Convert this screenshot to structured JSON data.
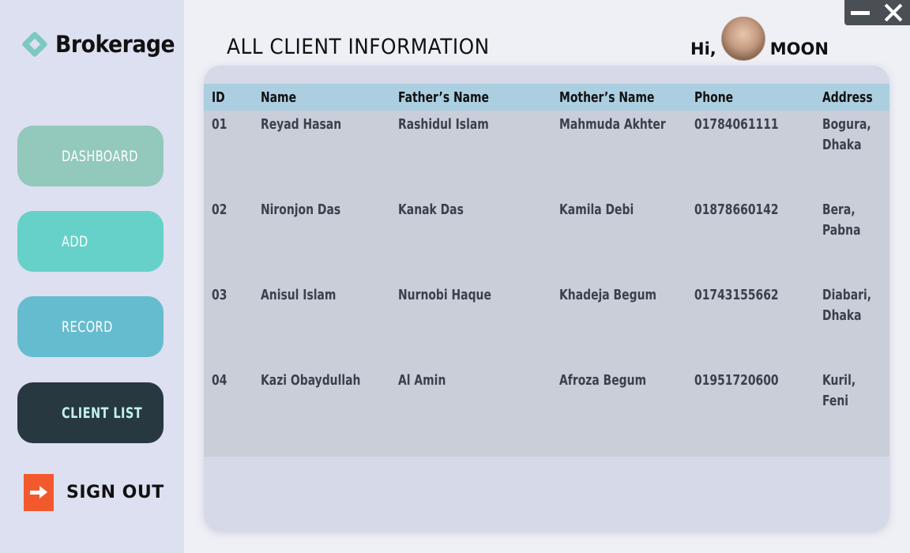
{
  "app": {
    "name": "Brokerage"
  },
  "sidebar": {
    "items": [
      {
        "label": "DASHBOARD"
      },
      {
        "label": "ADD"
      },
      {
        "label": "RECORD"
      },
      {
        "label": "CLIENT LIST"
      }
    ],
    "signout_label": "SIGN OUT"
  },
  "header": {
    "title": "ALL CLIENT INFORMATION",
    "greeting": "Hi,",
    "user_name": "MOON"
  },
  "table": {
    "columns": [
      "ID",
      "Name",
      "Father’s Name",
      "Mother’s Name",
      "Phone",
      "Address"
    ],
    "rows": [
      [
        "01",
        "Reyad Hasan",
        "Rashidul Islam",
        "Mahmuda Akhter",
        "01784061111",
        "Bogura, Dhaka"
      ],
      [
        "02",
        "Nironjon Das",
        "Kanak Das",
        "Kamila Debi",
        "01878660142",
        "Bera, Pabna"
      ],
      [
        "03",
        "Anisul Islam",
        "Nurnobi Haque",
        "Khadeja Begum",
        "01743155662",
        "Diabari, Dhaka"
      ],
      [
        "04",
        "Kazi Obaydullah",
        "Al Amin",
        "Afroza Begum",
        "01951720600",
        "Kuril, Feni"
      ]
    ]
  },
  "colors": {
    "sidebar_bg": "#dde0f0",
    "dashboard_btn": "#93c8bc",
    "add_btn": "#66d1c8",
    "record_btn": "#66bccf",
    "client_list_btn_active": "#283840",
    "signout_icon": "#f25a2e",
    "table_header": "#abcfe0"
  },
  "icons": {
    "logo": "diamond-logo-icon",
    "signout": "exit-arrow-icon",
    "minimize": "minimize-icon",
    "close": "close-icon"
  }
}
